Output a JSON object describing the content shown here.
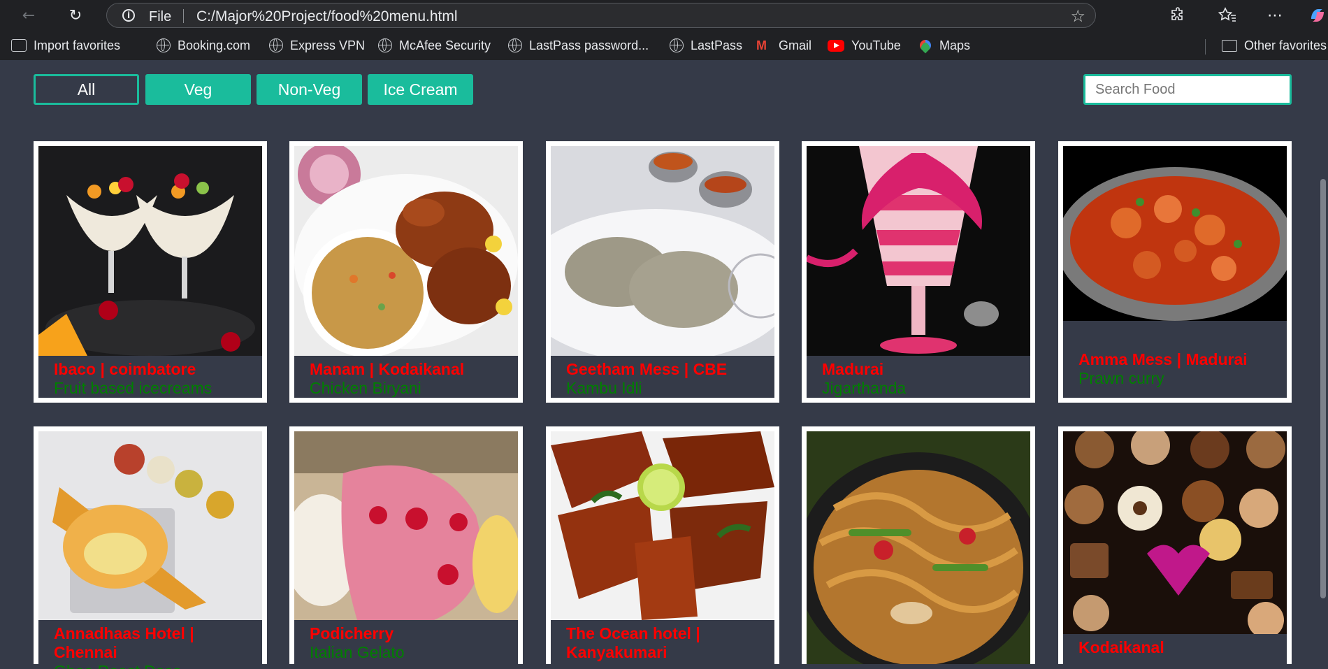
{
  "browser": {
    "url": "C:/Major%20Project/food%20menu.html",
    "protocol_label": "File",
    "bookmarks": [
      {
        "label": "Import favorites",
        "icon": "import-icon"
      },
      {
        "label": "Booking.com",
        "icon": "globe-icon"
      },
      {
        "label": "Express VPN",
        "icon": "globe-icon"
      },
      {
        "label": "McAfee Security",
        "icon": "globe-icon"
      },
      {
        "label": "LastPass password...",
        "icon": "globe-icon"
      },
      {
        "label": "LastPass",
        "icon": "globe-icon"
      },
      {
        "label": "Gmail",
        "icon": "gmail-icon"
      },
      {
        "label": "YouTube",
        "icon": "youtube-icon"
      },
      {
        "label": "Maps",
        "icon": "maps-icon"
      },
      {
        "label": "Other favorites",
        "icon": "folder-icon"
      }
    ]
  },
  "filters": {
    "buttons": [
      {
        "label": "All",
        "active": true
      },
      {
        "label": "Veg",
        "active": false
      },
      {
        "label": "Non-Veg",
        "active": false
      },
      {
        "label": "Ice Cream",
        "active": false
      }
    ],
    "search_placeholder": "Search Food",
    "accent_color": "#1abc9c"
  },
  "cards": [
    {
      "place": "Ibaco | coimbatore",
      "dish": "Fruit based icecreams",
      "image": "fruit-icecream-photo"
    },
    {
      "place": "Manam | Kodaikanal",
      "dish": "Chicken Biryani",
      "image": "chicken-biryani-photo"
    },
    {
      "place": "Geetham Mess | CBE",
      "dish": "Kambu Idli",
      "image": "kambu-idli-photo"
    },
    {
      "place": "Madurai",
      "dish": "Jigarthanda",
      "image": "jigarthanda-photo"
    },
    {
      "place": "Amma Mess | Madurai",
      "dish": "Prawn curry",
      "image": "prawn-curry-photo"
    },
    {
      "place": "Annadhaas Hotel | Chennai",
      "dish": "Ghee Roast Dosa",
      "image": "ghee-roast-dosa-photo"
    },
    {
      "place": "Podicherry",
      "dish": "Italian Gelato",
      "image": "italian-gelato-photo"
    },
    {
      "place": "The Ocean hotel | Kanyakumari",
      "dish": "",
      "image": "fish-fry-photo"
    },
    {
      "place": "",
      "dish": "",
      "image": "noodles-photo"
    },
    {
      "place": "Kodaikanal",
      "dish": "",
      "image": "chocolates-photo"
    }
  ]
}
